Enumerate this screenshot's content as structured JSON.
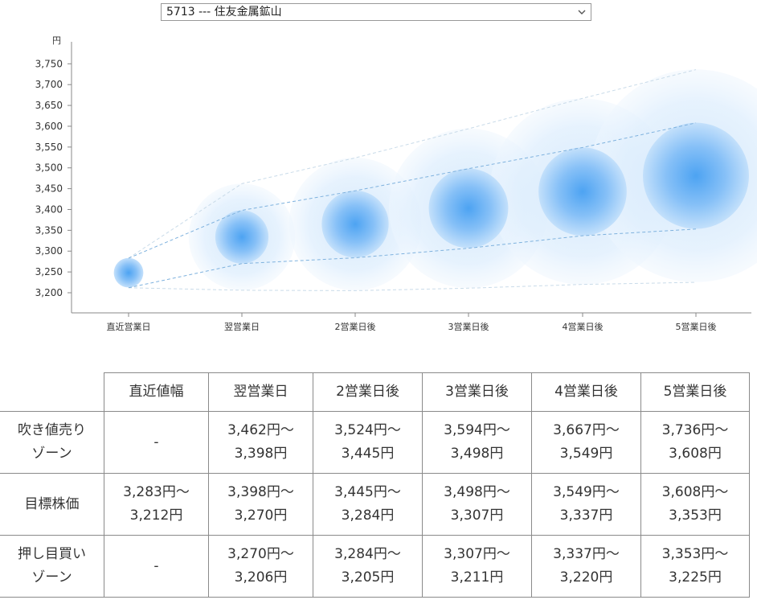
{
  "selector": {
    "value": "5713 --- 住友金属鉱山"
  },
  "chart_data": {
    "type": "scatter",
    "yunit": "円",
    "ylim": [
      3180,
      3790
    ],
    "yticks": [
      3200,
      3250,
      3300,
      3350,
      3400,
      3450,
      3500,
      3550,
      3600,
      3650,
      3700,
      3750
    ],
    "categories": [
      "直近営業日",
      "翌営業日",
      "2営業日後",
      "3営業日後",
      "4営業日後",
      "5営業日後"
    ],
    "center": [
      3248,
      3334,
      3365,
      3403,
      3443,
      3481
    ],
    "target_high": [
      3283,
      3398,
      3445,
      3498,
      3549,
      3608
    ],
    "target_low": [
      3212,
      3270,
      3284,
      3307,
      3337,
      3353
    ],
    "outer_high": [
      3283,
      3462,
      3524,
      3594,
      3667,
      3736
    ],
    "outer_low": [
      3212,
      3206,
      3205,
      3211,
      3220,
      3225
    ]
  },
  "table": {
    "headers": [
      "直近値幅",
      "翌営業日",
      "2営業日後",
      "3営業日後",
      "4営業日後",
      "5営業日後"
    ],
    "rows": [
      {
        "label": [
          "吹き値売り",
          "ゾーン"
        ],
        "cells": [
          [
            "-"
          ],
          [
            "3,462円～",
            "3,398円"
          ],
          [
            "3,524円～",
            "3,445円"
          ],
          [
            "3,594円～",
            "3,498円"
          ],
          [
            "3,667円～",
            "3,549円"
          ],
          [
            "3,736円～",
            "3,608円"
          ]
        ]
      },
      {
        "label": [
          "目標株価"
        ],
        "cells": [
          [
            "3,283円～",
            "3,212円"
          ],
          [
            "3,398円～",
            "3,270円"
          ],
          [
            "3,445円～",
            "3,284円"
          ],
          [
            "3,498円～",
            "3,307円"
          ],
          [
            "3,549円～",
            "3,337円"
          ],
          [
            "3,608円～",
            "3,353円"
          ]
        ]
      },
      {
        "label": [
          "押し目買い",
          "ゾーン"
        ],
        "cells": [
          [
            "-"
          ],
          [
            "3,270円～",
            "3,206円"
          ],
          [
            "3,284円～",
            "3,205円"
          ],
          [
            "3,307円～",
            "3,211円"
          ],
          [
            "3,337円～",
            "3,220円"
          ],
          [
            "3,353円～",
            "3,225円"
          ]
        ]
      }
    ]
  }
}
